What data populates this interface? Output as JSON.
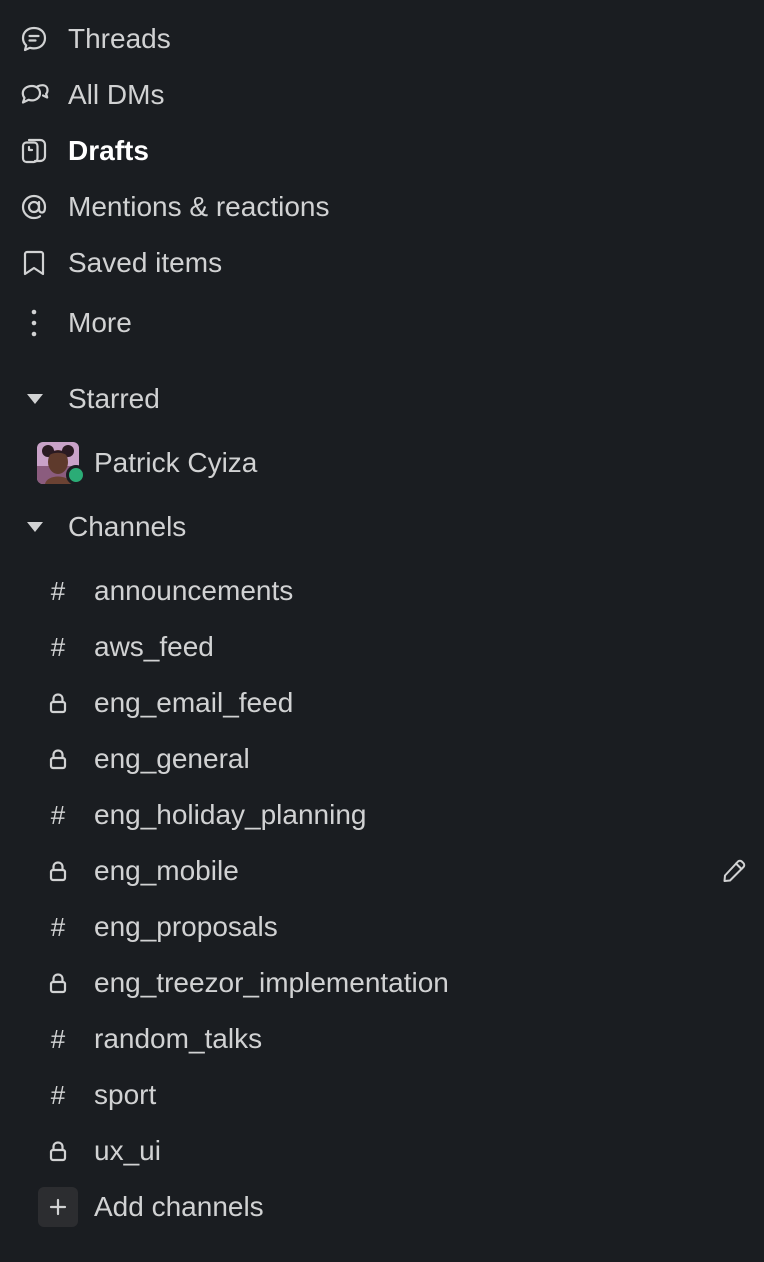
{
  "nav": {
    "threads": "Threads",
    "all_dms": "All DMs",
    "drafts": "Drafts",
    "mentions": "Mentions & reactions",
    "saved": "Saved items",
    "more": "More"
  },
  "starred": {
    "header": "Starred",
    "dm_name": "Patrick Cyiza",
    "presence": "active",
    "presence_color": "#2bac76"
  },
  "channels": {
    "header": "Channels",
    "items": [
      {
        "name": "announcements",
        "type": "public"
      },
      {
        "name": "aws_feed",
        "type": "public"
      },
      {
        "name": "eng_email_feed",
        "type": "private"
      },
      {
        "name": "eng_general",
        "type": "private"
      },
      {
        "name": "eng_holiday_planning",
        "type": "public"
      },
      {
        "name": "eng_mobile",
        "type": "private"
      },
      {
        "name": "eng_proposals",
        "type": "public"
      },
      {
        "name": "eng_treezor_implementation",
        "type": "private"
      },
      {
        "name": "random_talks",
        "type": "public"
      },
      {
        "name": "sport",
        "type": "public"
      },
      {
        "name": "ux_ui",
        "type": "private"
      }
    ],
    "add_label": "Add channels"
  },
  "icons": {
    "threads": "threads-icon",
    "all_dms": "dms-icon",
    "drafts": "drafts-icon",
    "mentions": "at-icon",
    "saved": "bookmark-icon",
    "more": "more-vertical-icon",
    "public_channel": "hash-icon",
    "private_channel": "lock-icon",
    "edit": "pencil-icon",
    "add": "plus-icon"
  },
  "colors": {
    "background": "#1a1d21",
    "text": "#d1d2d3",
    "active_text": "#ffffff"
  }
}
